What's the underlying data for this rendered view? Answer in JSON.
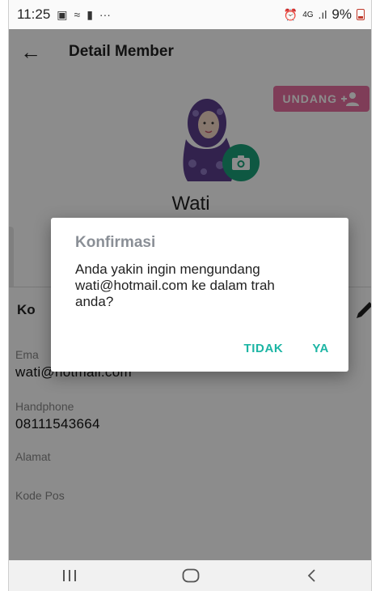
{
  "status_bar": {
    "time": "11:25",
    "network": "4G",
    "battery": "9%"
  },
  "app_bar": {
    "title": "Detail Member"
  },
  "profile": {
    "invite_label": "UNDANG",
    "name": "Wati"
  },
  "section": {
    "title": "Ko"
  },
  "fields": [
    {
      "label": "Ema",
      "value": "wati@hotmail.com"
    },
    {
      "label": "Handphone",
      "value": "08111543664"
    },
    {
      "label": "Alamat",
      "value": ""
    },
    {
      "label": "Kode Pos",
      "value": ""
    }
  ],
  "dialog": {
    "title": "Konfirmasi",
    "message": "Anda yakin ingin mengundang wati@hotmail.com ke dalam trah anda?",
    "cancel_label": "TIDAK",
    "confirm_label": "YA"
  },
  "colors": {
    "accent": "#1cb5a4",
    "invite": "#e86fa0",
    "camera": "#1aa179"
  }
}
